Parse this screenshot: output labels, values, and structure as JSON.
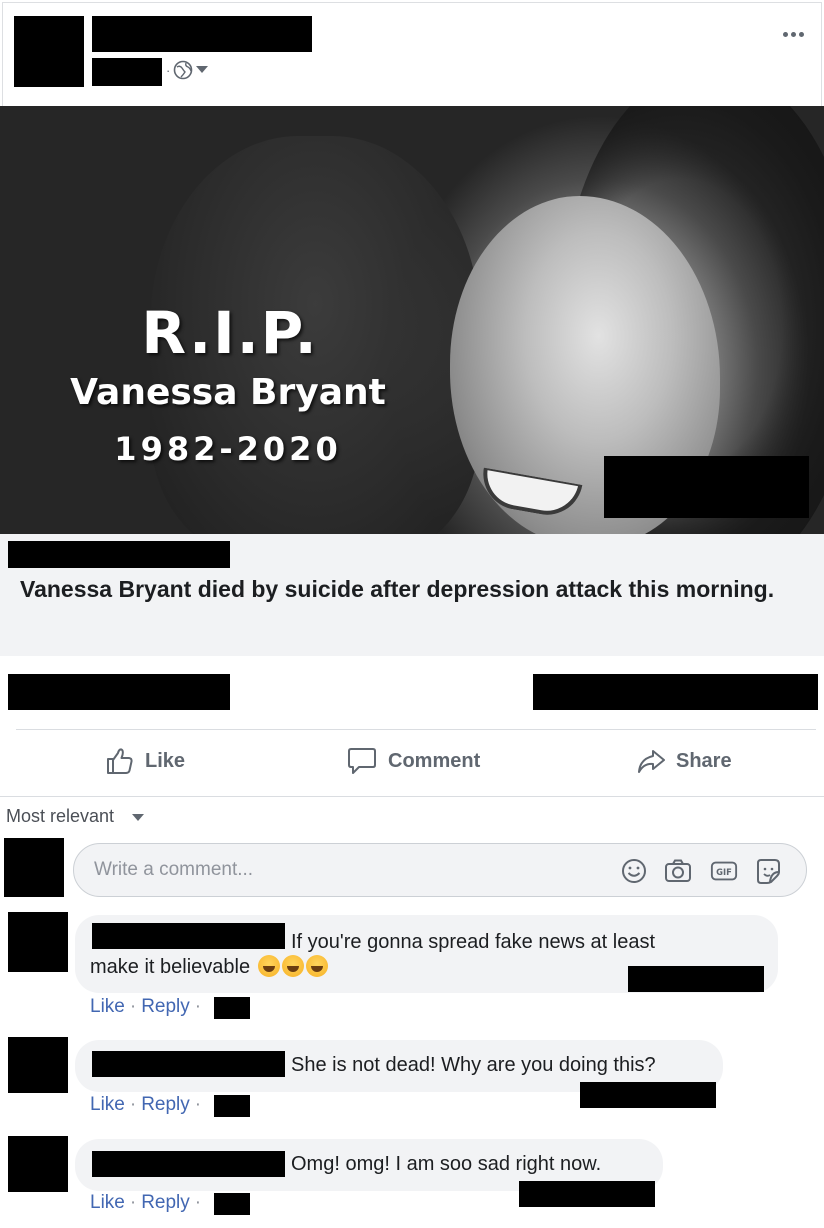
{
  "post": {
    "meta_separator": "·",
    "more_label": "More options",
    "photo": {
      "overlay_rip": "R.I.P.",
      "overlay_name": "Vanessa Bryant",
      "overlay_years": "1982-2020"
    },
    "caption": "Vanessa Bryant died by suicide after depression attack this morning."
  },
  "actions": {
    "like": "Like",
    "comment": "Comment",
    "share": "Share"
  },
  "comments_section": {
    "sort_label": "Most relevant",
    "composer_placeholder": "Write a comment..."
  },
  "comments": [
    {
      "text_line1": "If you're gonna spread fake news at least",
      "text_line2": "make it believable",
      "like": "Like",
      "reply": "Reply",
      "sep": "·"
    },
    {
      "text_line1": "She is not dead! Why are you doing this?",
      "like": "Like",
      "reply": "Reply",
      "sep": "·"
    },
    {
      "text_line1": "Omg! omg! I am soo sad right now.",
      "like": "Like",
      "reply": "Reply",
      "sep": "·"
    }
  ],
  "colors": {
    "link": "#4267b2",
    "muted": "#606770",
    "bubble": "#f2f3f5"
  }
}
